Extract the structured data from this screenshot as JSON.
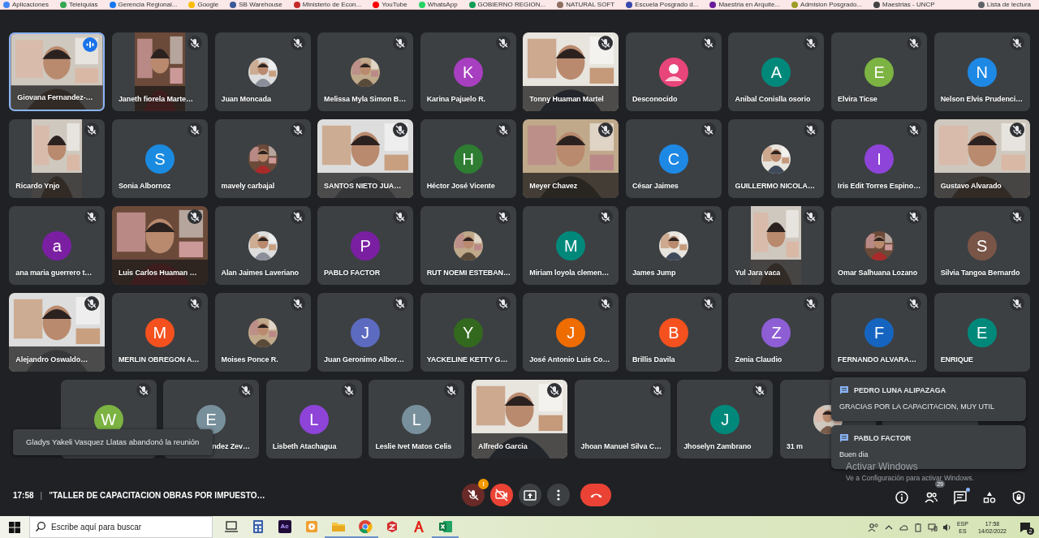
{
  "bookmarks": [
    {
      "label": "Aplicaciones",
      "color": "#4285f4"
    },
    {
      "label": "Teleiquias",
      "color": "#34a853"
    },
    {
      "label": "Gerencia Regional...",
      "color": "#1877f2"
    },
    {
      "label": "Google",
      "color": "#fbbc05"
    },
    {
      "label": "SB Warehouse",
      "color": "#3b5998"
    },
    {
      "label": "Ministerio de Econ...",
      "color": "#c62828"
    },
    {
      "label": "YouTube",
      "color": "#ff0000"
    },
    {
      "label": "WhatsApp",
      "color": "#25d366"
    },
    {
      "label": "GOBIERNO REGION...",
      "color": "#0f9d58"
    },
    {
      "label": "NATURAL SOFT",
      "color": "#8d6e63"
    },
    {
      "label": "Escuela Posgrado d...",
      "color": "#3949ab"
    },
    {
      "label": "Maestria en Arquite...",
      "color": "#6a1b9a"
    },
    {
      "label": "Admision Posgrado...",
      "color": "#9e9d24"
    },
    {
      "label": "Maestrias - UNCP",
      "color": "#424242"
    },
    {
      "label": "Lista de lectura",
      "color": "#5f6368"
    }
  ],
  "participants": [
    {
      "name": "Giovana Fernandez-…",
      "kind": "video",
      "speaking": true,
      "muted": false
    },
    {
      "name": "Janeth fiorela Marte…",
      "kind": "portrait",
      "speaking": false,
      "muted": true
    },
    {
      "name": "Juan Moncada",
      "speaking": false,
      "muted": true
    },
    {
      "name": "Melissa Myla Simon B…",
      "speaking": false,
      "muted": true
    },
    {
      "name": "Karina Pajuelo R.",
      "kind": "letter",
      "letter": "K",
      "color": "#a83fc0",
      "speaking": false,
      "muted": true
    },
    {
      "name": "Tonny Huaman Martel",
      "kind": "video",
      "speaking": false,
      "muted": true
    },
    {
      "name": "Desconocido",
      "kind": "anon",
      "color": "#e8457a",
      "speaking": false,
      "muted": true
    },
    {
      "name": "Anibal Conislla osorio",
      "kind": "letter",
      "letter": "A",
      "color": "#00897b",
      "speaking": false,
      "muted": true
    },
    {
      "name": "Elvira Ticse",
      "kind": "letter",
      "letter": "E",
      "color": "#7cb342",
      "speaking": false,
      "muted": true
    },
    {
      "name": "Nelson Elvis Prudenci…",
      "kind": "letter",
      "letter": "N",
      "color": "#1e88e5",
      "speaking": false,
      "muted": true
    },
    {
      "name": "Ricardo Ynjo",
      "kind": "portrait",
      "speaking": false,
      "muted": true
    },
    {
      "name": "Sonia Albornoz",
      "kind": "letter",
      "letter": "S",
      "color": "#1a8be0",
      "speaking": false,
      "muted": true
    },
    {
      "name": "mavely carbajal",
      "speaking": false,
      "muted": true
    },
    {
      "name": "SANTOS NIETO JUA…",
      "kind": "video",
      "speaking": false,
      "muted": true
    },
    {
      "name": "Héctor José Vicente",
      "kind": "letter",
      "letter": "H",
      "color": "#2e7d32",
      "speaking": false,
      "muted": true
    },
    {
      "name": "Meyer Chavez",
      "kind": "video",
      "speaking": false,
      "muted": true
    },
    {
      "name": "César Jaimes",
      "kind": "letter",
      "letter": "C",
      "color": "#1e88e5",
      "speaking": false,
      "muted": true
    },
    {
      "name": "GUILLERMO NICOLA…",
      "speaking": false,
      "muted": true
    },
    {
      "name": "Iris Edit Torres Espino…",
      "kind": "letter",
      "letter": "I",
      "color": "#8e44d8",
      "speaking": false,
      "muted": true
    },
    {
      "name": "Gustavo Alvarado",
      "kind": "video",
      "speaking": false,
      "muted": true
    },
    {
      "name": "ana maria guerrero t…",
      "kind": "letter",
      "letter": "a",
      "color": "#7b1fa2",
      "speaking": false,
      "muted": true
    },
    {
      "name": "Luis Carlos Huaman …",
      "kind": "video",
      "speaking": false,
      "muted": true
    },
    {
      "name": "Alan Jaimes Laveriano",
      "speaking": false,
      "muted": true
    },
    {
      "name": "PABLO FACTOR",
      "kind": "letter",
      "letter": "P",
      "color": "#7b1fa2",
      "speaking": false,
      "muted": true
    },
    {
      "name": "RUT NOEMI ESTEBAN…",
      "speaking": false,
      "muted": true
    },
    {
      "name": "Miriam loyola clemen…",
      "kind": "letter",
      "letter": "M",
      "color": "#00897b",
      "speaking": false,
      "muted": true
    },
    {
      "name": "James Jump",
      "speaking": false,
      "muted": true
    },
    {
      "name": "Yul Jara vaca",
      "kind": "portrait",
      "speaking": false,
      "muted": true
    },
    {
      "name": "Omar Salhuana Lozano",
      "speaking": false,
      "muted": true
    },
    {
      "name": "Silvia Tangoa Bernardo",
      "kind": "letter",
      "letter": "S",
      "color": "#795548",
      "speaking": false,
      "muted": true
    },
    {
      "name": "Alejandro Oswaldo…",
      "kind": "video",
      "speaking": false,
      "muted": true
    },
    {
      "name": "MERLIN OBREGON A…",
      "kind": "letter",
      "letter": "M",
      "color": "#f4511e",
      "speaking": false,
      "muted": true
    },
    {
      "name": "Moises Ponce R.",
      "speaking": false,
      "muted": true
    },
    {
      "name": "Juan Geronimo Albor…",
      "kind": "letter",
      "letter": "J",
      "color": "#5c6bc0",
      "speaking": false,
      "muted": true
    },
    {
      "name": "YACKELINE KETTY G…",
      "kind": "letter",
      "letter": "Y",
      "color": "#33691e",
      "speaking": false,
      "muted": true
    },
    {
      "name": "José Antonio Luis Co…",
      "kind": "letter",
      "letter": "J",
      "color": "#ef6c00",
      "speaking": false,
      "muted": true
    },
    {
      "name": "Brillis Davila",
      "kind": "letter",
      "letter": "B",
      "color": "#f4511e",
      "speaking": false,
      "muted": true
    },
    {
      "name": "Zenia Claudio",
      "kind": "letter",
      "letter": "Z",
      "color": "#8e5ed5",
      "speaking": false,
      "muted": true
    },
    {
      "name": "FERNANDO ALVARA…",
      "kind": "letter",
      "letter": "F",
      "color": "#1565c0",
      "speaking": false,
      "muted": true
    },
    {
      "name": "ENRIQUE",
      "kind": "letter",
      "letter": "E",
      "color": "#00897b",
      "speaking": false,
      "muted": true
    },
    {
      "kind": "letter",
      "letter": "W",
      "color": "#7cb342",
      "speaking": false,
      "muted": true
    },
    {
      "name": "ndez Zev…",
      "kind": "letter",
      "letter": "E",
      "color": "#78909c",
      "speaking": false,
      "muted": true
    },
    {
      "name": "Lisbeth Atachagua",
      "kind": "letter",
      "letter": "L",
      "color": "#8e44d8",
      "speaking": false,
      "muted": true
    },
    {
      "name": "Leslie Ivet Matos Celis",
      "kind": "letter",
      "letter": "L",
      "color": "#78909c",
      "speaking": false,
      "muted": true
    },
    {
      "name": "Alfredo Garcia",
      "kind": "video",
      "speaking": false,
      "muted": true
    },
    {
      "name": "Jhoan Manuel Silva C…",
      "kind": "blank",
      "speaking": false,
      "muted": true
    },
    {
      "name": "Jhoselyn Zambrano",
      "kind": "letter",
      "letter": "J",
      "color": "#00897b",
      "speaking": false,
      "muted": true
    },
    {
      "name": "31 m",
      "speaking": false,
      "muted": false
    },
    {
      "kind": "blank",
      "speaking": false,
      "muted": false
    }
  ],
  "toast": "Gladys Yakeli Vasquez Llatas abandonó la reunión",
  "notifications": [
    {
      "sender": "PEDRO LUNA ALIPAZAGA",
      "message": "GRACIAS POR LA CAPACITACION, MUY UTIL"
    },
    {
      "sender": "PABLO FACTOR",
      "message": "Buen dia"
    }
  ],
  "meeting": {
    "time": "17:58",
    "separator": "|",
    "title": "\"TALLER DE CAPACITACION OBRAS POR IMPUESTO…"
  },
  "controls": [
    {
      "kind": "mic",
      "on": false,
      "badge": "!"
    },
    {
      "kind": "camera",
      "on": false
    },
    {
      "kind": "present"
    },
    {
      "kind": "more"
    },
    {
      "kind": "hangup"
    }
  ],
  "side_controls": [
    {
      "kind": "info"
    },
    {
      "kind": "people",
      "badge": "29"
    },
    {
      "kind": "chat",
      "unread": true
    },
    {
      "kind": "activities"
    },
    {
      "kind": "security"
    }
  ],
  "activation": {
    "title": "Activar Windows",
    "text": "Ve a Configuración para activar Windows."
  },
  "taskbar": {
    "search_placeholder": "Escribe aquí para buscar",
    "apps": [
      {
        "kind": "taskview"
      },
      {
        "kind": "calculator"
      },
      {
        "kind": "ae",
        "label": "Ae"
      },
      {
        "kind": "media"
      },
      {
        "kind": "folder",
        "running": true
      },
      {
        "kind": "chrome",
        "running": true
      },
      {
        "kind": "redapp"
      },
      {
        "kind": "acrobat"
      },
      {
        "kind": "excel",
        "running": true
      }
    ],
    "language": "ESP",
    "layout": "ES",
    "clock": "17:58",
    "date": "14/02/2022",
    "notification_count": "2"
  }
}
